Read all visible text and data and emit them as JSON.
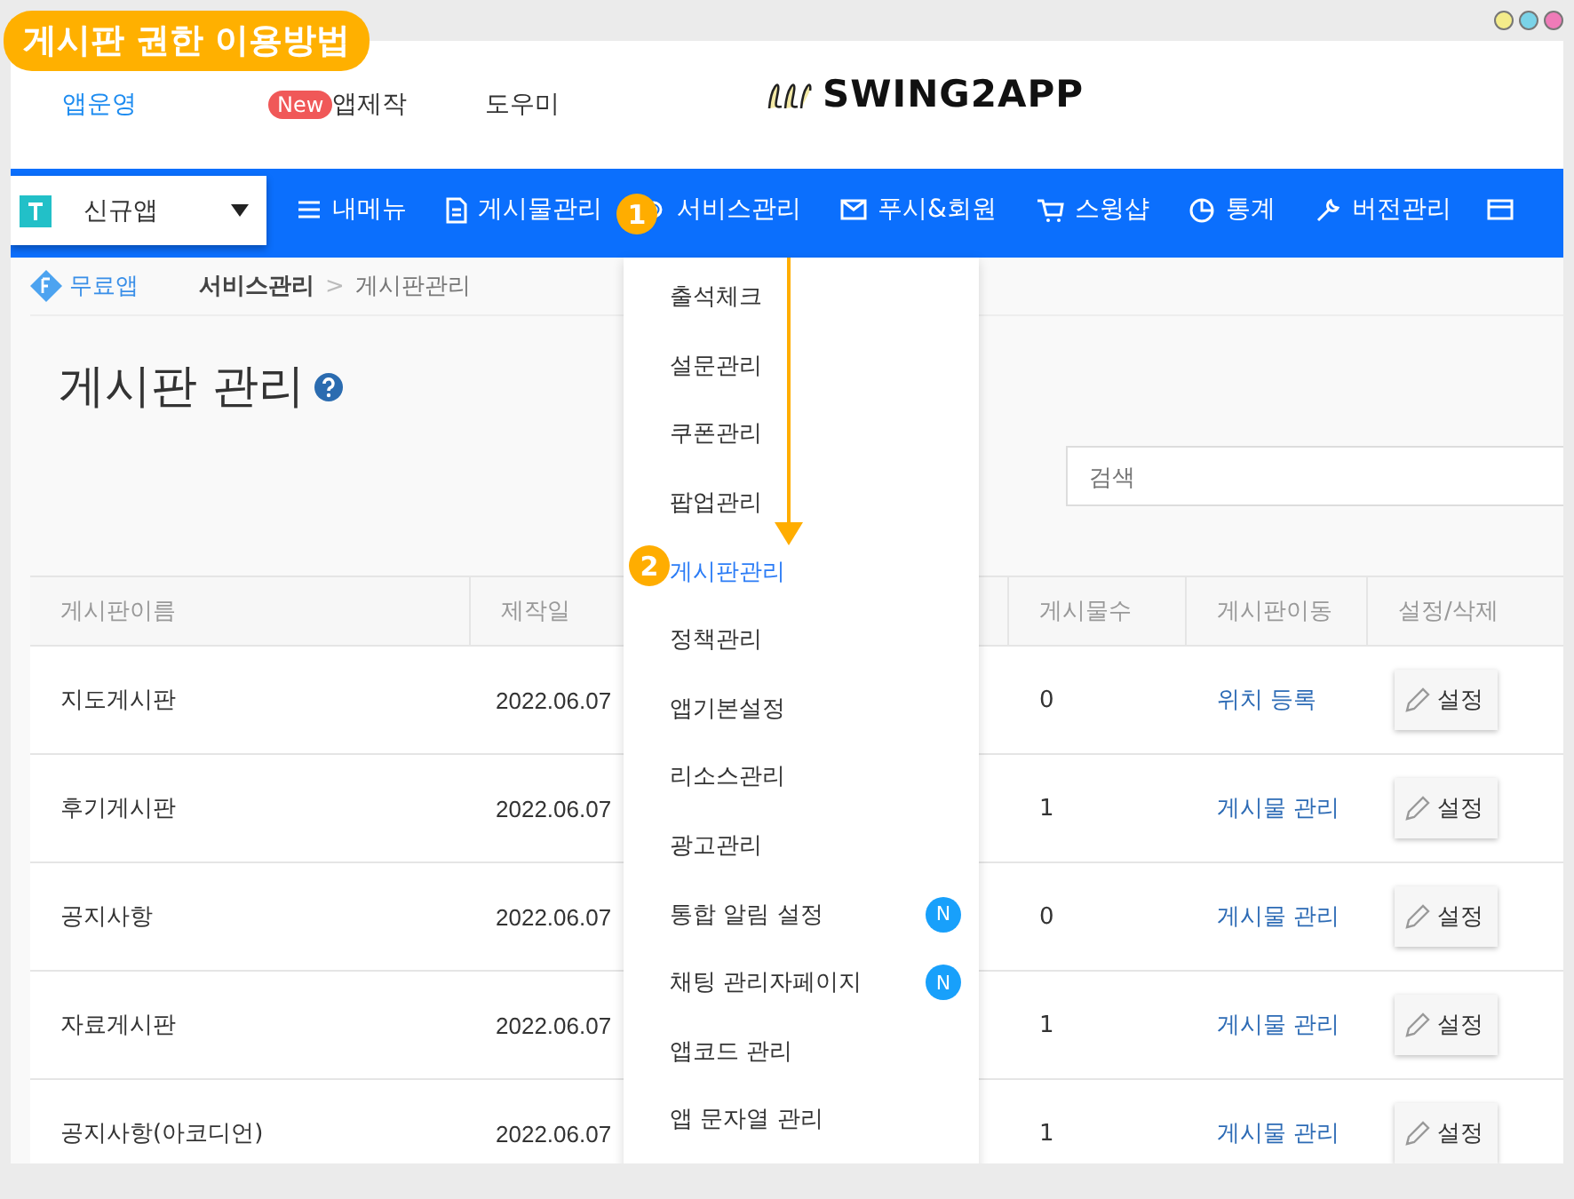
{
  "banner": {
    "title": "게시판 권한 이용방법"
  },
  "top_nav": [
    {
      "label": "앱운영",
      "selected": true
    },
    {
      "label": "앱제작",
      "badge": "New",
      "selected": false
    },
    {
      "label": "도우미",
      "selected": false
    }
  ],
  "logo": "SWING2APP",
  "app_selector": {
    "value": "신규앱"
  },
  "main_nav": [
    {
      "label": "내메뉴"
    },
    {
      "label": "게시물관리"
    },
    {
      "label": "서비스관리"
    },
    {
      "label": "푸시&회원"
    },
    {
      "label": "스윙샵"
    },
    {
      "label": "통계"
    },
    {
      "label": "버전관리"
    }
  ],
  "breadcrumb": {
    "plan": "무료앱",
    "section": "서비스관리",
    "separator": ">",
    "page": "게시판관리"
  },
  "page_title": "게시판 관리",
  "search": {
    "placeholder": "검색"
  },
  "table": {
    "columns": [
      "게시판이름",
      "제작일",
      "게시물수",
      "게시판이동",
      "설정/삭제"
    ],
    "rows": [
      {
        "name": "지도게시판",
        "date": "2022.06.07",
        "count": "0",
        "move": "위치 등록",
        "action": "설정"
      },
      {
        "name": "후기게시판",
        "date": "2022.06.07",
        "count": "1",
        "move": "게시물 관리",
        "action": "설정"
      },
      {
        "name": "공지사항",
        "date": "2022.06.07",
        "count": "0",
        "move": "게시물 관리",
        "action": "설정"
      },
      {
        "name": "자료게시판",
        "date": "2022.06.07",
        "count": "1",
        "move": "게시물 관리",
        "action": "설정"
      },
      {
        "name": "공지사항(아코디언)",
        "date": "2022.06.07",
        "count": "1",
        "move": "게시물 관리",
        "action": "설정"
      }
    ]
  },
  "dropdown": [
    {
      "label": "출석체크",
      "selected": false
    },
    {
      "label": "설문관리",
      "selected": false
    },
    {
      "label": "쿠폰관리",
      "selected": false
    },
    {
      "label": "팝업관리",
      "selected": false
    },
    {
      "label": "게시판관리",
      "selected": true
    },
    {
      "label": "정책관리",
      "selected": false
    },
    {
      "label": "앱기본설정",
      "selected": false
    },
    {
      "label": "리소스관리",
      "selected": false
    },
    {
      "label": "광고관리",
      "selected": false
    },
    {
      "label": "통합 알림 설정",
      "badge": "N",
      "selected": false
    },
    {
      "label": "채팅 관리자페이지",
      "badge": "N",
      "selected": false
    },
    {
      "label": "앱코드 관리",
      "selected": false
    },
    {
      "label": "앱 문자열 관리",
      "selected": false
    }
  ],
  "steps": [
    "1",
    "2"
  ]
}
